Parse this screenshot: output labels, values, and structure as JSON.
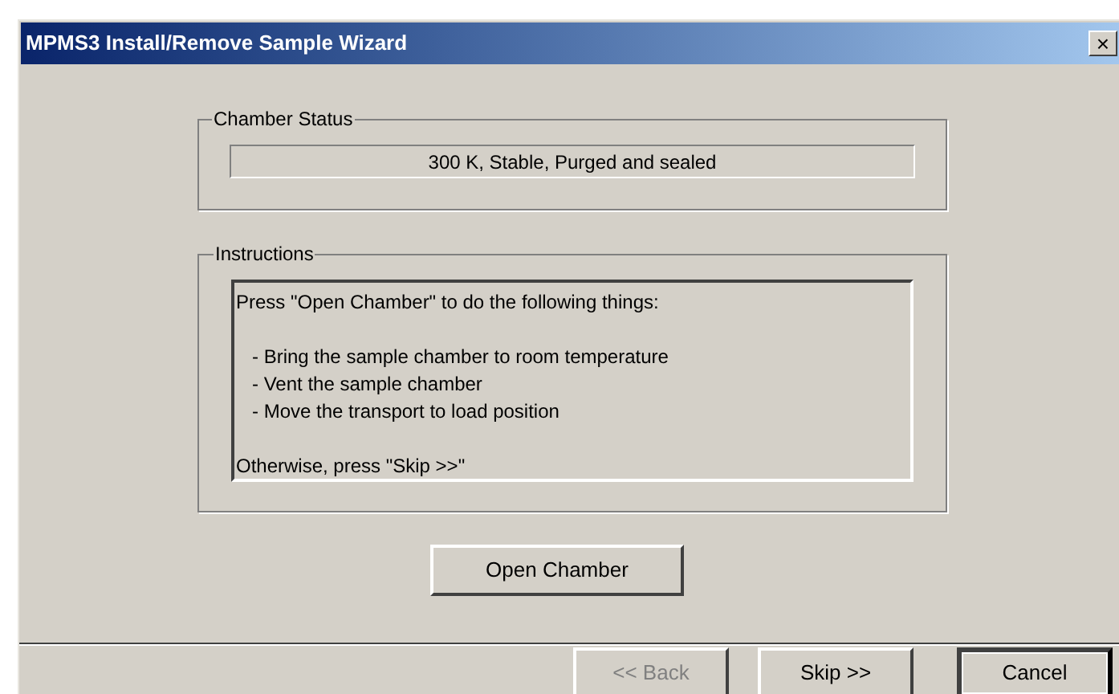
{
  "window": {
    "title": "MPMS3 Install/Remove Sample Wizard",
    "close": "×"
  },
  "chamber_status": {
    "label": "Chamber Status",
    "value": "300 K, Stable, Purged and sealed"
  },
  "instructions": {
    "label": "Instructions",
    "intro": "Press \"Open Chamber\" to do the following things:",
    "steps": [
      "- Bring the sample chamber to room temperature",
      "- Vent the sample chamber",
      "- Move the transport to load position"
    ],
    "outro": "Otherwise, press \"Skip >>\""
  },
  "action_button": "Open Chamber",
  "buttons": [
    {
      "label": "<< Back",
      "disabled": true,
      "default": false
    },
    {
      "label": "Skip >>",
      "disabled": false,
      "default": false
    },
    {
      "label": "Cancel",
      "disabled": false,
      "default": true
    }
  ]
}
